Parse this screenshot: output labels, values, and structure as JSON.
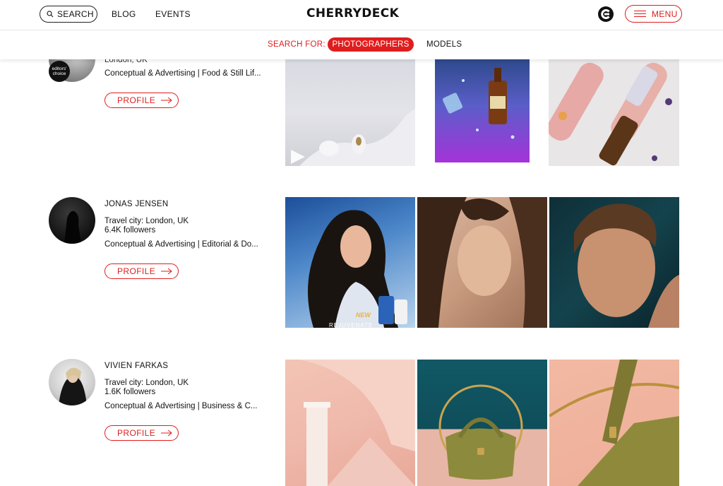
{
  "header": {
    "search_label": "SEARCH",
    "nav": [
      "BLOG",
      "EVENTS"
    ],
    "logo_text": "CHERRYDECK",
    "menu_label": "MENU"
  },
  "filter": {
    "label": "SEARCH FOR:",
    "active": "PHOTOGRAPHERS",
    "other": "MODELS"
  },
  "accent_color": "#e01d1d",
  "profiles": [
    {
      "name": "",
      "location": "London, UK",
      "followers": "",
      "tags": "Conceptual & Advertising | Food & Still Lif...",
      "badge": "editors' choice",
      "button": "PROFILE"
    },
    {
      "name": "JONAS JENSEN",
      "location": "Travel city: London, UK",
      "followers": "6.4K followers",
      "tags": "Conceptual & Advertising | Editorial & Do...",
      "button": "PROFILE",
      "ad_text_new": "NEW",
      "ad_text_caption": "REJUVENATE"
    },
    {
      "name": "VIVIEN FARKAS",
      "location": "Travel city: London, UK",
      "followers": "1.6K followers",
      "tags": "Conceptual & Advertising | Business & C...",
      "button": "PROFILE"
    }
  ]
}
